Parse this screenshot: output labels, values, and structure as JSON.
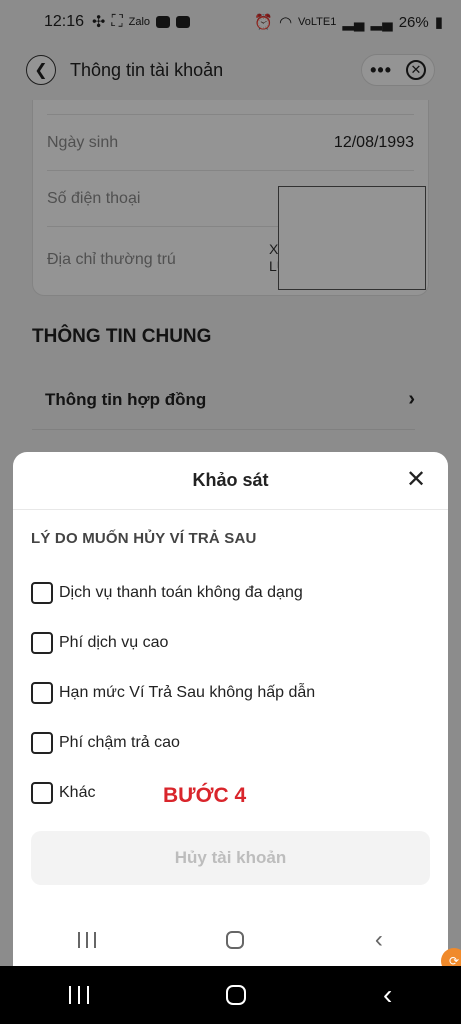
{
  "status_bar": {
    "time": "12:16",
    "left_icons": [
      "fan-icon",
      "screenshot-icon",
      "zalo-icon",
      "youtube-icon",
      "youtube-icon"
    ],
    "zalo_label": "Zalo",
    "right_icons": [
      "alarm-icon",
      "wifi-icon",
      "signal-icon",
      "signal-icon",
      "battery-icon"
    ],
    "network_label": "VoLTE1",
    "battery": "26%"
  },
  "app_bar": {
    "title": "Thông tin tài khoản",
    "back_icon": "chevron-left-icon",
    "more_icon": "more-dots-icon",
    "close_icon": "close-circle-icon"
  },
  "account_info": {
    "birth_label": "Ngày sinh",
    "birth_value": "12/08/1993",
    "phone_label": "Số điện thoại",
    "address_label": "Địa chỉ thường trú",
    "address_value_line1": "XÃ",
    "address_value_line2": "LƯƠ"
  },
  "general": {
    "section_title": "THÔNG TIN CHUNG",
    "contract_label": "Thông tin hợp đồng"
  },
  "survey_sheet": {
    "title": "Khảo sát",
    "question": "LÝ DO MUỐN HỦY VÍ TRẢ SAU",
    "options": [
      "Dịch vụ thanh toán không đa dạng",
      "Phí dịch vụ cao",
      "Hạn mức Ví Trả Sau không hấp dẫn",
      "Phí chậm trả cao",
      "Khác"
    ],
    "step_label": "BƯỚC 4",
    "submit_label": "Hủy tài khoản"
  },
  "colors": {
    "step_red": "#d9252b",
    "badge_orange": "#f08a2b",
    "disabled_text": "#bdbdbd"
  }
}
